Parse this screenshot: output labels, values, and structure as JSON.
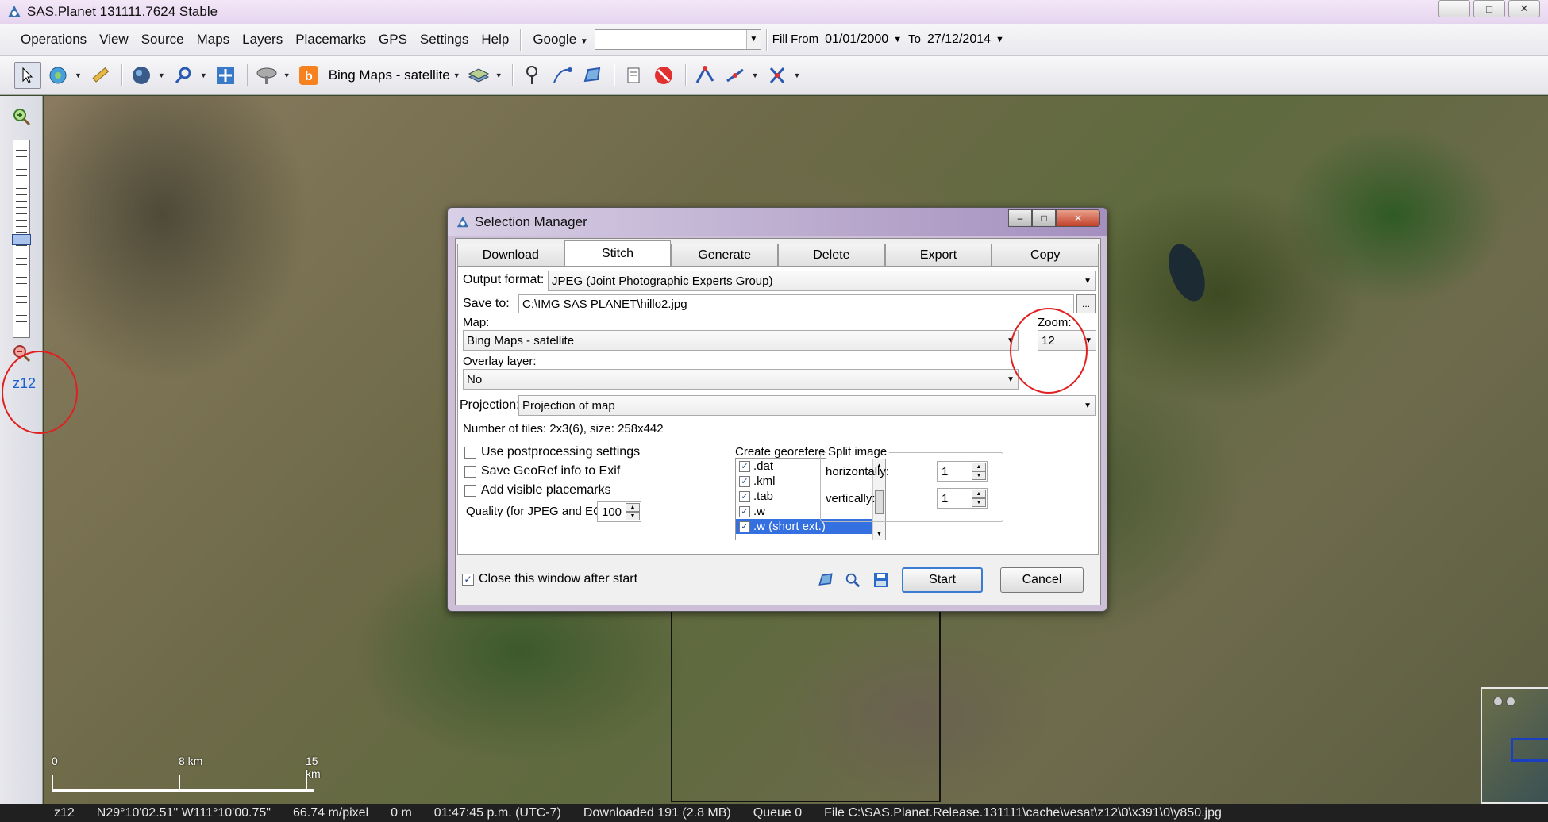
{
  "window": {
    "title": "SAS.Planet 131111.7624 Stable",
    "controls": [
      "–",
      "□",
      "✕"
    ]
  },
  "menu": {
    "items": [
      "Operations",
      "View",
      "Source",
      "Maps",
      "Layers",
      "Placemarks",
      "GPS",
      "Settings",
      "Help"
    ],
    "search_provider": "Google",
    "search_value": "",
    "fill_from_label": "Fill From",
    "fill_from_date": "01/01/2000",
    "to_label": "To",
    "to_date": "27/12/2014"
  },
  "toolbar": {
    "map_source": "Bing Maps - satellite",
    "icons": [
      "cursor-icon",
      "globe-settings-icon",
      "ruler-icon",
      "earth-icon",
      "magnifier-icon",
      "fullscreen-icon",
      "satellite-dish-icon",
      "bing-icon",
      "layers-icon",
      "placemark-icon",
      "path-icon",
      "polygon-icon",
      "placemark-list-icon",
      "stop-icon",
      "select-polygon-icon",
      "select-line-icon",
      "select-rect-icon"
    ]
  },
  "left_panel": {
    "zoom_level_label": "z12",
    "zoom_thumb_fraction": 0.5
  },
  "map": {
    "scale_labels": [
      "0",
      "8 km",
      "15 km"
    ]
  },
  "dialog": {
    "title": "Selection Manager",
    "tabs": [
      "Download",
      "Stitch",
      "Generate",
      "Delete",
      "Export",
      "Copy"
    ],
    "active_tab": "Stitch",
    "output_format_label": "Output format:",
    "output_format_value": "JPEG (Joint Photographic Experts Group)",
    "save_to_label": "Save to:",
    "save_to_value": "C:\\IMG SAS PLANET\\hillo2.jpg",
    "browse_label": "...",
    "map_label": "Map:",
    "map_value": "Bing Maps - satellite",
    "zoom_label": "Zoom:",
    "zoom_value": "12",
    "overlay_label": "Overlay layer:",
    "overlay_value": "No",
    "projection_label": "Projection:",
    "projection_value": "Projection of map",
    "tiles_info": "Number of tiles: 2x3(6), size: 258x442",
    "options": [
      {
        "label": "Use postprocessing settings",
        "checked": false
      },
      {
        "label": "Save GeoRef info to Exif",
        "checked": false
      },
      {
        "label": "Add visible placemarks",
        "checked": false
      }
    ],
    "quality_label": "Quality (for JPEG and ECW):",
    "quality_value": "100",
    "georef_label": "Create georeferencing file:",
    "georef_items": [
      {
        "label": ".dat",
        "checked": true,
        "selected": false
      },
      {
        "label": ".kml",
        "checked": true,
        "selected": false
      },
      {
        "label": ".tab",
        "checked": true,
        "selected": false
      },
      {
        "label": ".w",
        "checked": true,
        "selected": false
      },
      {
        "label": ".w (short ext.)",
        "checked": true,
        "selected": true
      }
    ],
    "split_label": "Split image",
    "split_h_label": "horizontally:",
    "split_h_value": "1",
    "split_v_label": "vertically:",
    "split_v_value": "1",
    "close_after_start_label": "Close this window after start",
    "close_after_start_checked": true,
    "start_label": "Start",
    "cancel_label": "Cancel"
  },
  "status": {
    "zoom": "z12",
    "coords": "N29°10'02.51\" W111°10'00.75\"",
    "resolution": "66.74 m/pixel",
    "elevation": "0 m",
    "time": "01:47:45 p.m. (UTC-7)",
    "downloaded": "Downloaded 191 (2.8 MB)",
    "queue": "Queue 0",
    "file": "File C:\\SAS.Planet.Release.131111\\cache\\vesat\\z12\\0\\x391\\0\\y850.jpg"
  }
}
